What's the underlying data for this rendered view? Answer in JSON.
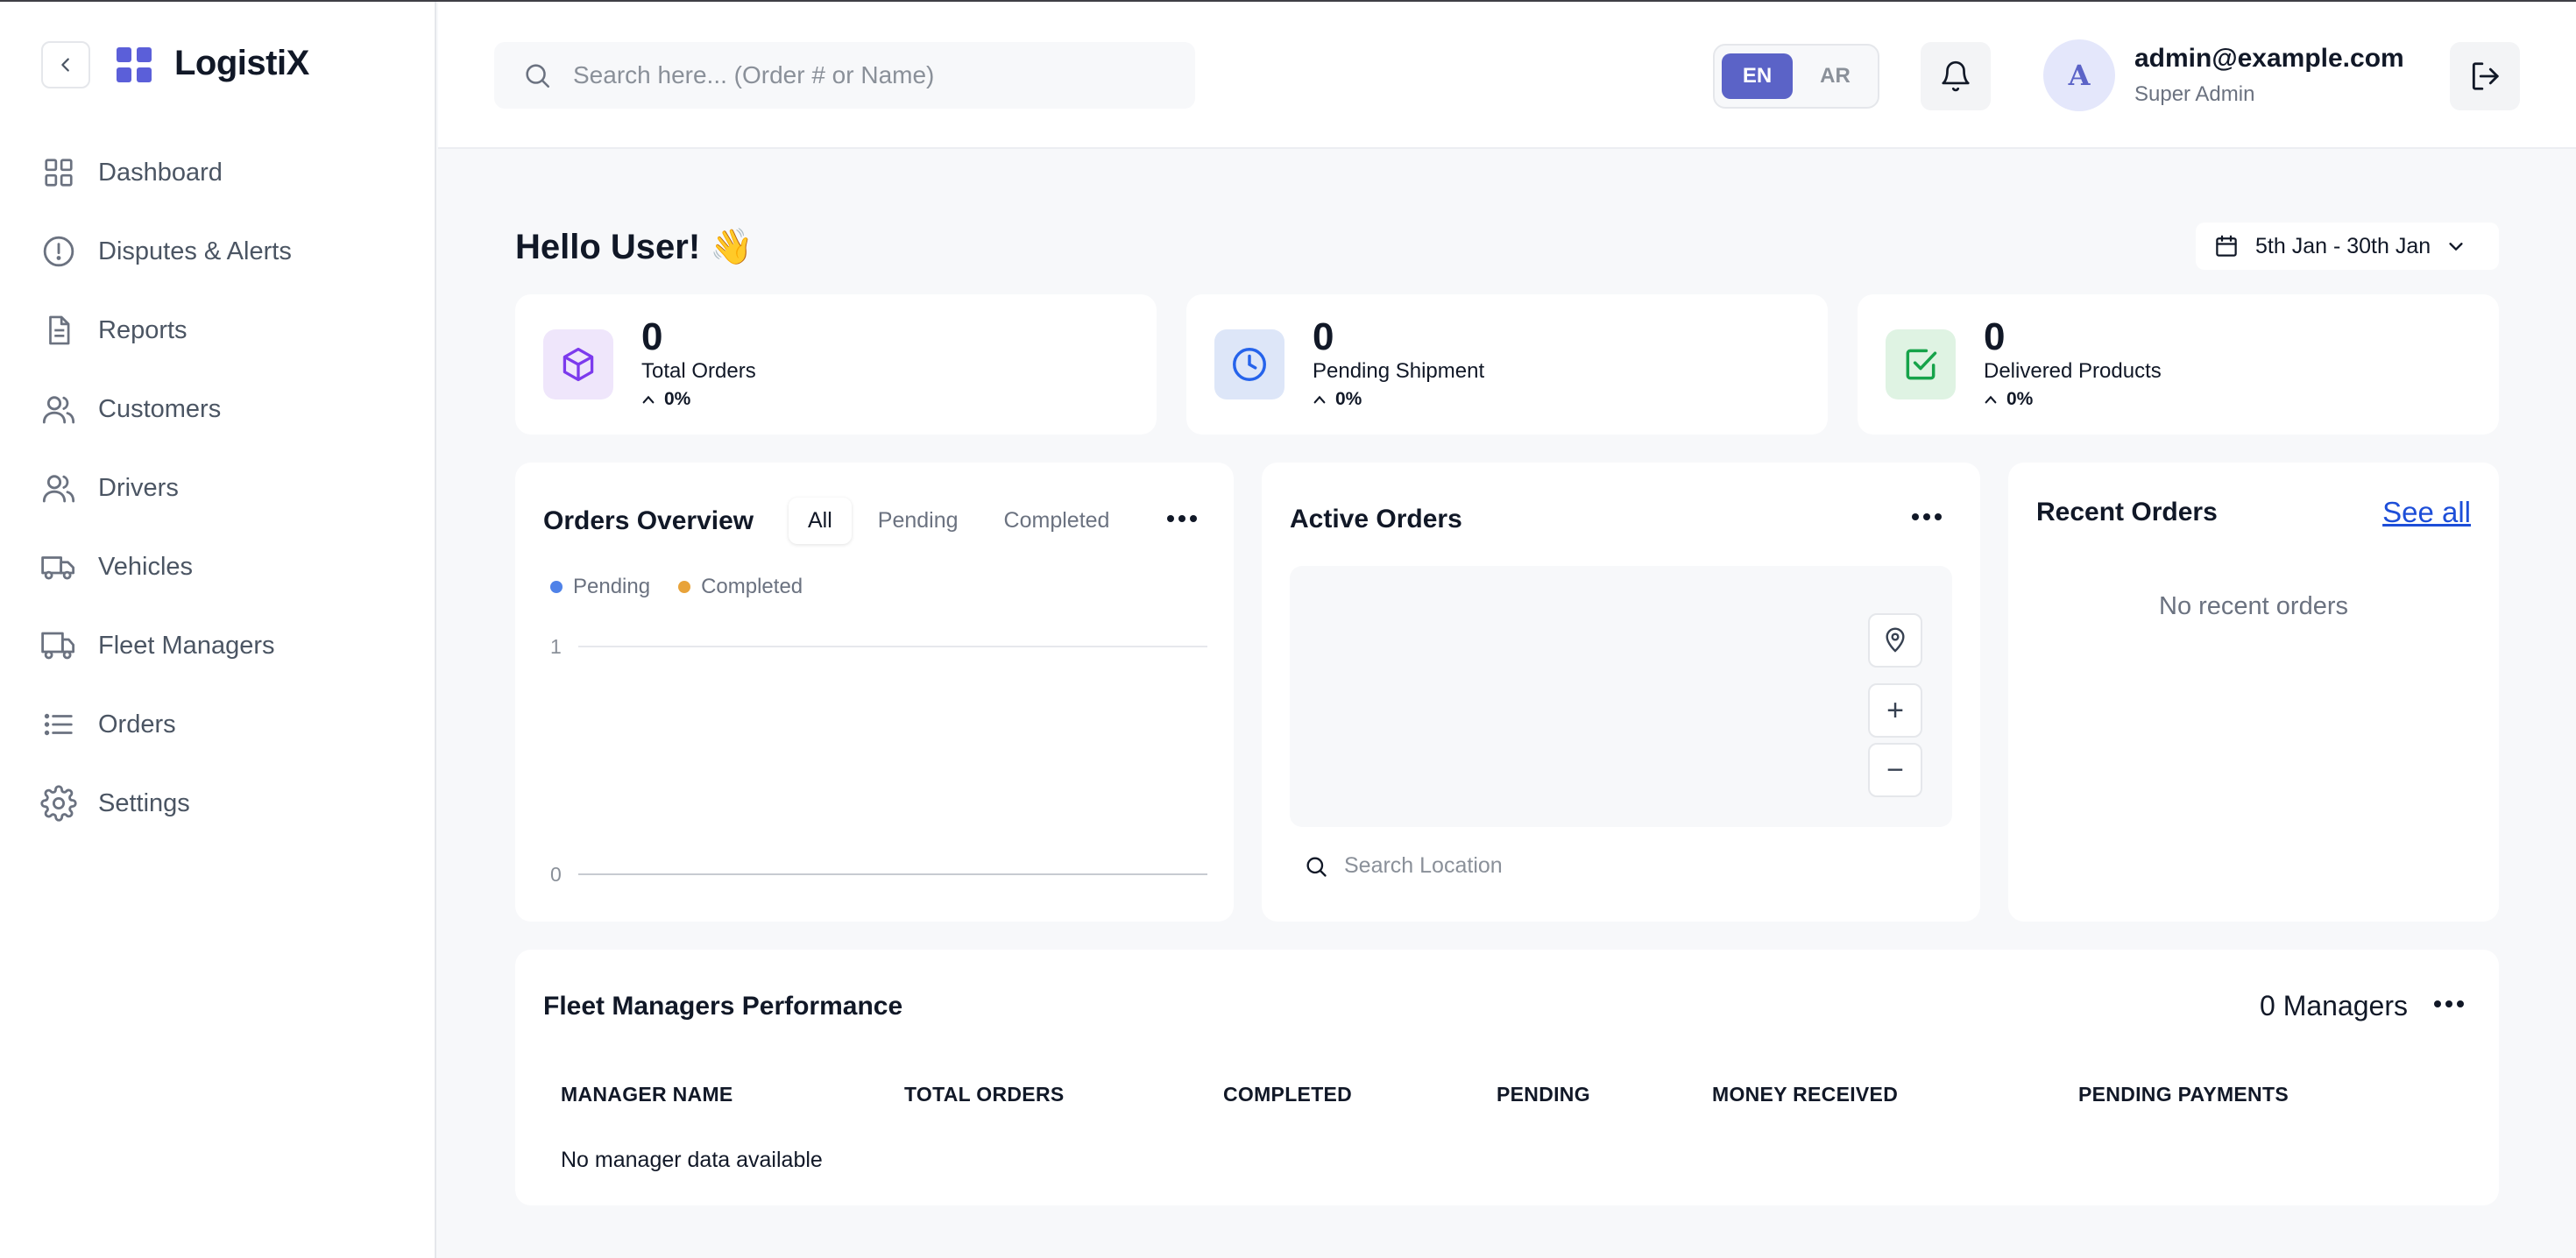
{
  "app": {
    "name": "LogistiX",
    "brand_color": "#5b5fd9"
  },
  "sidebar": {
    "collapse_icon": "chevron-left-icon",
    "items": [
      {
        "label": "Dashboard",
        "icon": "grid-icon"
      },
      {
        "label": "Disputes & Alerts",
        "icon": "alert-circle-icon"
      },
      {
        "label": "Reports",
        "icon": "document-icon"
      },
      {
        "label": "Customers",
        "icon": "users-icon"
      },
      {
        "label": "Drivers",
        "icon": "users-icon"
      },
      {
        "label": "Vehicles",
        "icon": "truck-icon"
      },
      {
        "label": "Fleet Managers",
        "icon": "truck-icon"
      },
      {
        "label": "Orders",
        "icon": "list-icon"
      },
      {
        "label": "Settings",
        "icon": "gear-icon"
      }
    ]
  },
  "header": {
    "search_placeholder": "Search here... (Order # or Name)",
    "lang": {
      "en": "EN",
      "ar": "AR",
      "selected": "EN"
    },
    "user": {
      "avatar_letter": "A",
      "email": "admin@example.com",
      "role": "Super Admin"
    }
  },
  "main": {
    "greeting": "Hello User! 👋",
    "date_range": "5th Jan - 30th Jan",
    "stats": [
      {
        "value": "0",
        "label": "Total Orders",
        "change": "0%",
        "icon": "box-icon",
        "color": "#7c3aed"
      },
      {
        "value": "0",
        "label": "Pending Shipment",
        "change": "0%",
        "icon": "clock-icon",
        "color": "#2563eb"
      },
      {
        "value": "0",
        "label": "Delivered Products",
        "change": "0%",
        "icon": "check-square-icon",
        "color": "#16a34a"
      }
    ],
    "orders_overview": {
      "title": "Orders Overview",
      "tabs": [
        "All",
        "Pending",
        "Completed"
      ],
      "active_tab": "All",
      "legend": [
        {
          "label": "Pending",
          "color": "#4f82e8"
        },
        {
          "label": "Completed",
          "color": "#e8a33a"
        }
      ]
    },
    "active_orders": {
      "title": "Active Orders",
      "zoom_in": "+",
      "zoom_out": "−",
      "location_placeholder": "Search Location"
    },
    "recent_orders": {
      "title": "Recent Orders",
      "see_all": "See all",
      "empty": "No recent orders"
    },
    "fleet_performance": {
      "title": "Fleet Managers Performance",
      "count_label": "0 Managers",
      "columns": [
        "MANAGER NAME",
        "TOTAL ORDERS",
        "COMPLETED",
        "PENDING",
        "MONEY RECEIVED",
        "PENDING PAYMENTS"
      ],
      "empty": "No manager data available"
    }
  },
  "chart_data": {
    "type": "line",
    "title": "",
    "series": [
      {
        "name": "Pending",
        "values": []
      },
      {
        "name": "Completed",
        "values": []
      }
    ],
    "ylim": [
      0,
      1
    ],
    "yticks": [
      "1",
      "0"
    ],
    "grid": true,
    "legend": "top-left"
  }
}
